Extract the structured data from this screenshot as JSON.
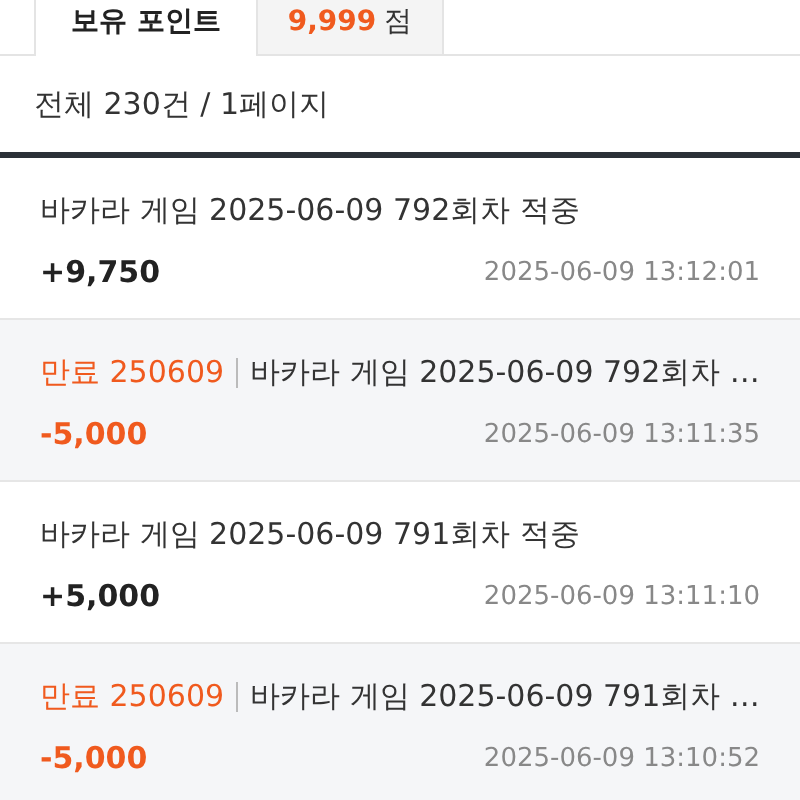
{
  "points": {
    "label": "보유 포인트",
    "value": "9,999",
    "unit": "점"
  },
  "summary": "전체 230건 / 1페이지",
  "entries": [
    {
      "kind": "earn",
      "title": "바카라 게임 2025-06-09 792회차 적중",
      "amount": "+9,750",
      "time": "2025-06-09 13:12:01"
    },
    {
      "kind": "expire",
      "expiry": "만료 250609",
      "title": "바카라 게임 2025-06-09 792회차 …",
      "amount": "-5,000",
      "time": "2025-06-09 13:11:35"
    },
    {
      "kind": "earn",
      "title": "바카라 게임 2025-06-09 791회차 적중",
      "amount": "+5,000",
      "time": "2025-06-09 13:11:10"
    },
    {
      "kind": "expire",
      "expiry": "만료 250609",
      "title": "바카라 게임 2025-06-09 791회차 …",
      "amount": "-5,000",
      "time": "2025-06-09 13:10:52"
    }
  ]
}
